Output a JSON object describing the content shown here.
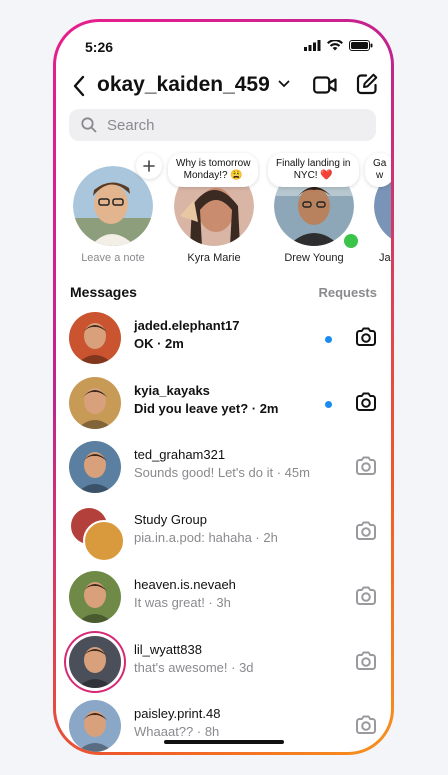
{
  "status": {
    "time": "5:26"
  },
  "header": {
    "username": "okay_kaiden_459"
  },
  "search": {
    "placeholder": "Search"
  },
  "notes": [
    {
      "name": "Leave a note",
      "note": ""
    },
    {
      "name": "Kyra Marie",
      "note": "Why is tomorrow\nMonday!? 😩"
    },
    {
      "name": "Drew Young",
      "note": "Finally landing in\nNYC! ❤️"
    },
    {
      "name": "Jac",
      "note": "Ga\nw"
    }
  ],
  "section": {
    "title": "Messages",
    "requests": "Requests"
  },
  "threads": [
    {
      "name": "jaded.elephant17",
      "preview": "OK · 2m",
      "unread": true,
      "color": "#c9542f"
    },
    {
      "name": "kyia_kayaks",
      "preview": "Did you leave yet? · 2m",
      "unread": true,
      "color": "#c79a56"
    },
    {
      "name": "ted_graham321",
      "preview": "Sounds good! Let's do it · 45m",
      "unread": false,
      "color": "#5a7fa0"
    },
    {
      "name": "Study Group",
      "preview": "pia.in.a.pod: hahaha · 2h",
      "unread": false,
      "color": "#b3403a"
    },
    {
      "name": "heaven.is.nevaeh",
      "preview": "It was great! · 3h",
      "unread": false,
      "color": "#6f8a47"
    },
    {
      "name": "lil_wyatt838",
      "preview": "that's awesome! · 3d",
      "unread": false,
      "color": "#4b4f5a"
    },
    {
      "name": "paisley.print.48",
      "preview": "Whaaat?? · 8h",
      "unread": false,
      "color": "#8aa7c7"
    }
  ],
  "colors": {
    "unread_dot": "#1a8cf0",
    "online": "#3cc44a",
    "frame_start": "#e91e8c",
    "frame_end": "#f7931e"
  }
}
